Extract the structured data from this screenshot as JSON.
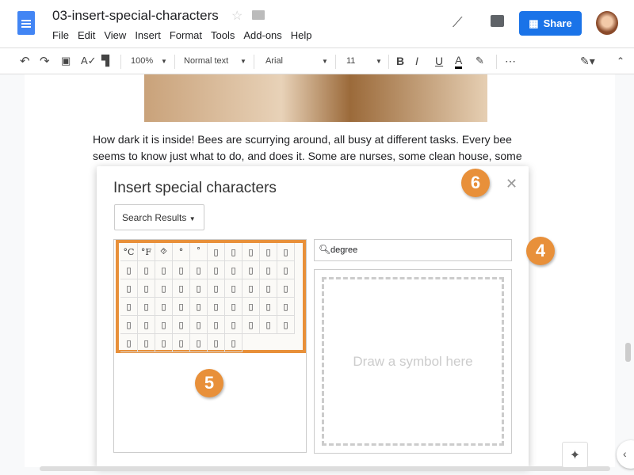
{
  "app": {
    "title": "03-insert-special-characters",
    "share_label": "Share",
    "menu": [
      "File",
      "Edit",
      "View",
      "Insert",
      "Format",
      "Tools",
      "Add-ons",
      "Help"
    ]
  },
  "toolbar": {
    "zoom": "100%",
    "style": "Normal text",
    "font": "Arial",
    "size": "11"
  },
  "document": {
    "paragraph": "How dark it is inside! Bees are scurrying around, all busy at different tasks. Every bee seems to know just what to do, and does it. Some are nurses, some clean house, some"
  },
  "dialog": {
    "title": "Insert special characters",
    "category": "Search Results",
    "search_value": "degree",
    "draw_placeholder": "Draw a symbol here",
    "results": [
      "°C",
      "°F",
      "⯑",
      "°",
      "˚",
      "▯",
      "▯",
      "▯",
      "▯",
      "▯",
      "▯",
      "▯",
      "▯",
      "▯",
      "▯",
      "▯",
      "▯",
      "▯",
      "▯",
      "▯",
      "▯",
      "▯",
      "▯",
      "▯",
      "▯",
      "▯",
      "▯",
      "▯",
      "▯",
      "▯",
      "▯",
      "▯",
      "▯",
      "▯",
      "▯",
      "▯",
      "▯",
      "▯",
      "▯",
      "▯",
      "▯",
      "▯",
      "▯",
      "▯",
      "▯",
      "▯",
      "▯",
      "▯",
      "▯",
      "▯",
      "▯",
      "▯",
      "▯",
      "▯",
      "▯",
      "▯",
      "▯"
    ]
  },
  "callouts": {
    "close": "6",
    "search": "4",
    "results": "5"
  },
  "colors": {
    "accent": "#e8903a",
    "share": "#1a73e8"
  }
}
